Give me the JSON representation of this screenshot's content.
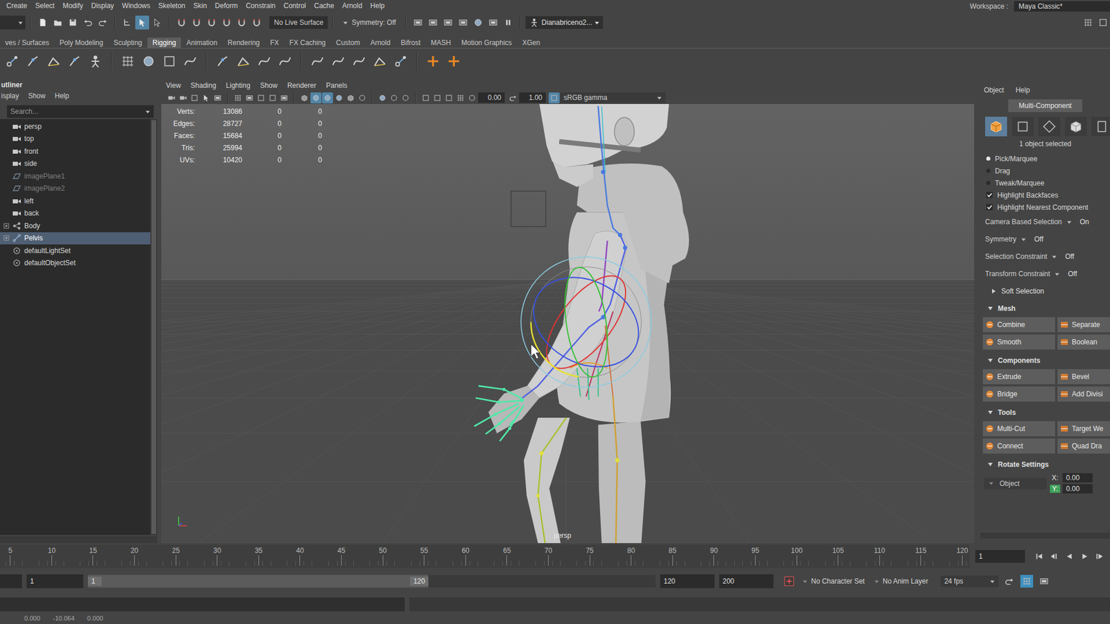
{
  "menu_bar": {
    "items": [
      "Create",
      "Select",
      "Modify",
      "Display",
      "Windows",
      "Skeleton",
      "Skin",
      "Deform",
      "Constrain",
      "Control",
      "Cache",
      "Arnold",
      "Help"
    ],
    "workspace_label": "Workspace :",
    "workspace": "Maya Classic*"
  },
  "status_line": {
    "select_modes": [
      {
        "kind": "hierarchy",
        "selected": false
      },
      {
        "kind": "object",
        "selected": true
      },
      {
        "kind": "component",
        "selected": false
      }
    ],
    "live_surface": "No Live Surface",
    "symmetry": "Symmetry: Off",
    "user": "Dianabriceno2..."
  },
  "shelf": {
    "tabs": [
      {
        "label": "ves / Surfaces",
        "selected": false
      },
      {
        "label": "Poly Modeling",
        "selected": false
      },
      {
        "label": "Sculpting",
        "selected": false
      },
      {
        "label": "Rigging",
        "selected": true
      },
      {
        "label": "Animation",
        "selected": false
      },
      {
        "label": "Rendering",
        "selected": false
      },
      {
        "label": "FX",
        "selected": false
      },
      {
        "label": "FX Caching",
        "selected": false
      },
      {
        "label": "Custom",
        "selected": false
      },
      {
        "label": "Arnold",
        "selected": false
      },
      {
        "label": "Bifrost",
        "selected": false
      },
      {
        "label": "MASH",
        "selected": false
      },
      {
        "label": "Motion Graphics",
        "selected": false
      },
      {
        "label": "XGen",
        "selected": false
      }
    ]
  },
  "outliner": {
    "title": "utliner",
    "menu": [
      "isplay",
      "Show",
      "Help"
    ],
    "search_placeholder": "Search...",
    "items": [
      {
        "label": "persp",
        "kind": "camera",
        "expandable": false,
        "selected": false,
        "dimmed": false
      },
      {
        "label": "top",
        "kind": "camera",
        "expandable": false,
        "selected": false,
        "dimmed": false
      },
      {
        "label": "front",
        "kind": "camera",
        "expandable": false,
        "selected": false,
        "dimmed": false
      },
      {
        "label": "side",
        "kind": "camera",
        "expandable": false,
        "selected": false,
        "dimmed": false
      },
      {
        "label": "imagePlane1",
        "kind": "image-plane",
        "expandable": false,
        "selected": false,
        "dimmed": true
      },
      {
        "label": "imagePlane2",
        "kind": "image-plane",
        "expandable": false,
        "selected": false,
        "dimmed": true
      },
      {
        "label": "left",
        "kind": "camera",
        "expandable": false,
        "selected": false,
        "dimmed": false
      },
      {
        "label": "back",
        "kind": "camera",
        "expandable": false,
        "selected": false,
        "dimmed": false
      },
      {
        "label": "Body",
        "kind": "mesh",
        "expandable": true,
        "selected": false,
        "dimmed": false
      },
      {
        "label": "Pelvis",
        "kind": "joint",
        "expandable": true,
        "selected": true,
        "dimmed": false
      },
      {
        "label": "defaultLightSet",
        "kind": "set",
        "expandable": false,
        "selected": false,
        "dimmed": false
      },
      {
        "label": "defaultObjectSet",
        "kind": "set",
        "expandable": false,
        "selected": false,
        "dimmed": false
      }
    ]
  },
  "viewport": {
    "menu": [
      "View",
      "Shading",
      "Lighting",
      "Show",
      "Renderer",
      "Panels"
    ],
    "toolbar": [
      {
        "kind": "cam",
        "on": false
      },
      {
        "kind": "cam",
        "on": false
      },
      {
        "kind": "box",
        "on": false
      },
      {
        "kind": "arrow",
        "on": false
      },
      {
        "kind": "film",
        "on": false
      },
      {
        "kind": "sep",
        "on": false
      },
      {
        "kind": "grid",
        "on": false
      },
      {
        "kind": "film",
        "on": false
      },
      {
        "kind": "box",
        "on": false
      },
      {
        "kind": "box",
        "on": false
      },
      {
        "kind": "film",
        "on": false
      },
      {
        "kind": "sep",
        "on": false
      },
      {
        "kind": "cube",
        "on": false
      },
      {
        "kind": "sphere",
        "on": true
      },
      {
        "kind": "sphere",
        "on": true
      },
      {
        "kind": "sphere",
        "on": false
      },
      {
        "kind": "cube",
        "on": false
      },
      {
        "kind": "circle",
        "on": false
      },
      {
        "kind": "sep",
        "on": false
      },
      {
        "kind": "sphere",
        "on": false
      },
      {
        "kind": "circle",
        "on": false
      },
      {
        "kind": "circle",
        "on": false
      },
      {
        "kind": "sep",
        "on": false
      },
      {
        "kind": "box",
        "on": false
      },
      {
        "kind": "box",
        "on": false
      },
      {
        "kind": "box",
        "on": false
      },
      {
        "kind": "grid",
        "on": false
      }
    ],
    "exposure": "0.00",
    "gamma": "1.00",
    "color_space": "sRGB gamma",
    "hud": [
      {
        "label": "Verts:",
        "values": [
          "13086",
          "0",
          "0"
        ]
      },
      {
        "label": "Edges:",
        "values": [
          "28727",
          "0",
          "0"
        ]
      },
      {
        "label": "Faces:",
        "values": [
          "15684",
          "0",
          "0"
        ]
      },
      {
        "label": "Tris:",
        "values": [
          "25994",
          "0",
          "0"
        ]
      },
      {
        "label": "UVs:",
        "values": [
          "10420",
          "0",
          "0"
        ]
      }
    ],
    "camera": "persp"
  },
  "toolkit": {
    "menu": [
      "Object",
      "Help"
    ],
    "mode_button": "Multi-Component",
    "selection_modes": [
      {
        "kind": "object",
        "selected": true
      },
      {
        "kind": "vertex",
        "selected": false
      },
      {
        "kind": "edge",
        "selected": false
      },
      {
        "kind": "face",
        "selected": false
      },
      {
        "kind": "uv",
        "selected": false
      }
    ],
    "status": "1 object selected",
    "pick_modes": [
      {
        "label": "Pick/Marquee",
        "selected": true
      },
      {
        "label": "Drag",
        "selected": false
      },
      {
        "label": "Tweak/Marquee",
        "selected": false
      }
    ],
    "checkboxes": [
      {
        "label": "Highlight Backfaces",
        "checked": true
      },
      {
        "label": "Highlight Nearest Component",
        "checked": true
      }
    ],
    "options": [
      {
        "label": "Camera Based Selection",
        "value": "On"
      },
      {
        "label": "Symmetry",
        "value": "Off"
      },
      {
        "label": "Selection Constraint",
        "value": "Off"
      },
      {
        "label": "Transform Constraint",
        "value": "Off"
      }
    ],
    "sections": [
      {
        "title": "Soft Selection",
        "expanded": false,
        "buttons": []
      },
      {
        "title": "Mesh",
        "expanded": true,
        "buttons": [
          "Combine",
          "Separate",
          "Smooth",
          "Boolean"
        ]
      },
      {
        "title": "Components",
        "expanded": true,
        "buttons": [
          "Extrude",
          "Bevel",
          "Bridge",
          "Add Divisi"
        ]
      },
      {
        "title": "Tools",
        "expanded": true,
        "buttons": [
          "Multi-Cut",
          "Target We",
          "Connect",
          "Quad Dra"
        ]
      }
    ],
    "rotate_settings": {
      "title": "Rotate Settings",
      "expanded": true,
      "space": "Object",
      "fields": [
        {
          "axis": "X:",
          "value": "0.00",
          "active": false
        },
        {
          "axis": "Y:",
          "value": "0.00",
          "active": true
        }
      ]
    }
  },
  "time_slider": {
    "ticks": [
      "5",
      "10",
      "15",
      "20",
      "25",
      "30",
      "35",
      "40",
      "45",
      "50",
      "55",
      "60",
      "65",
      "70",
      "75",
      "80",
      "85",
      "90",
      "95",
      "100",
      "105",
      "110",
      "115",
      "120"
    ],
    "current_frame": "1"
  },
  "range_slider": {
    "start_frame": "1",
    "range_start": "1",
    "range_end": "120",
    "level": 0.6,
    "end_frame": "120",
    "max_frame": "200",
    "character_set": "No Character Set",
    "anim_layer": "No Anim Layer",
    "fps": "24 fps"
  },
  "help_line": {
    "values": [
      "0.000",
      "-10.064",
      "0.000"
    ]
  }
}
